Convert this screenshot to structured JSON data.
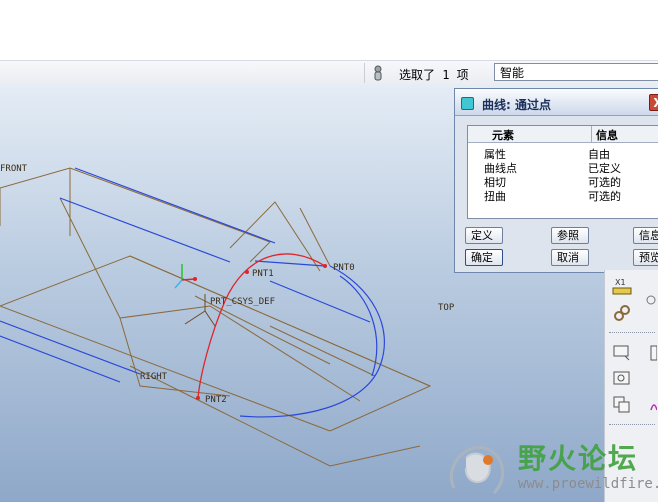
{
  "status_bar": {
    "selection_text": "选取了 1 项",
    "filter_value": "智能"
  },
  "viewport": {
    "datum_labels": {
      "front": "FRONT",
      "top": "TOP",
      "right": "RIGHT",
      "csys": "PRT_CSYS_DEF"
    },
    "point_labels": {
      "pnt0": "PNT0",
      "pnt1": "PNT1",
      "pnt2": "PNT2"
    },
    "colors": {
      "datum_plane": "#8a6a3c",
      "edge_blue": "#2b48d8",
      "curve_red": "#e0242a"
    }
  },
  "dialog": {
    "title": "曲线: 通过点",
    "close_label": "X",
    "table": {
      "headers": [
        "元素",
        "信息"
      ],
      "rows": [
        {
          "element": "属性",
          "info": "自由"
        },
        {
          "element": "曲线点",
          "info": "已定义"
        },
        {
          "element": "相切",
          "info": "可选的"
        },
        {
          "element": "扭曲",
          "info": "可选的"
        }
      ]
    },
    "buttons": {
      "define": "定义",
      "reference": "参照",
      "info": "信息",
      "ok": "确定",
      "cancel": "取消",
      "preview": "预览"
    }
  },
  "toolbar_right": {
    "icons": [
      "distance-icon",
      "link-icon",
      "flag-icon",
      "view-icon",
      "copy-icon",
      "sketch-icon",
      "text-icon"
    ]
  },
  "watermark": {
    "text": "野火论坛",
    "url": "www.proewildfire.cn"
  }
}
